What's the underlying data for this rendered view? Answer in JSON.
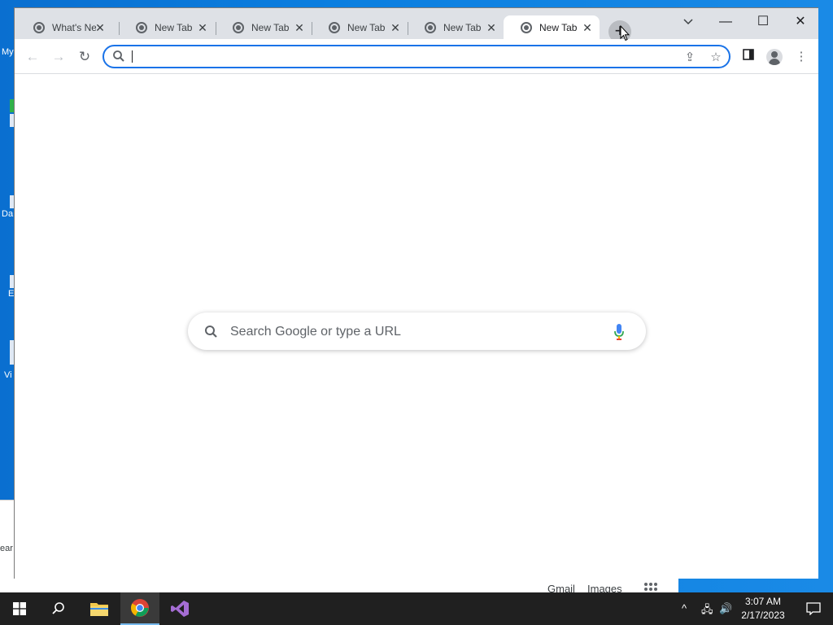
{
  "desktop": {
    "icon_labels": [
      "My",
      "Da",
      "E",
      "Vi"
    ],
    "search_fragment": "ear"
  },
  "browser": {
    "tabs": [
      {
        "label": "What's New",
        "active": false
      },
      {
        "label": "New Tab",
        "active": false
      },
      {
        "label": "New Tab",
        "active": false
      },
      {
        "label": "New Tab",
        "active": false
      },
      {
        "label": "New Tab",
        "active": false
      },
      {
        "label": "New Tab",
        "active": true
      }
    ],
    "new_tab_symbol": "+",
    "omnibox": {
      "value": "",
      "placeholder": ""
    },
    "window_controls": {
      "minimize": "—",
      "maximize": "☐",
      "close": "✕"
    }
  },
  "ntp": {
    "search_placeholder": "Search Google or type a URL",
    "links": {
      "gmail": "Gmail",
      "images": "Images"
    }
  },
  "taskbar": {
    "time": "3:07 AM",
    "date": "2/17/2023"
  },
  "colors": {
    "accent": "#1a73e8",
    "tabstrip": "#dee1e6",
    "desktop": "#0a78d4",
    "taskbar": "#202020"
  }
}
